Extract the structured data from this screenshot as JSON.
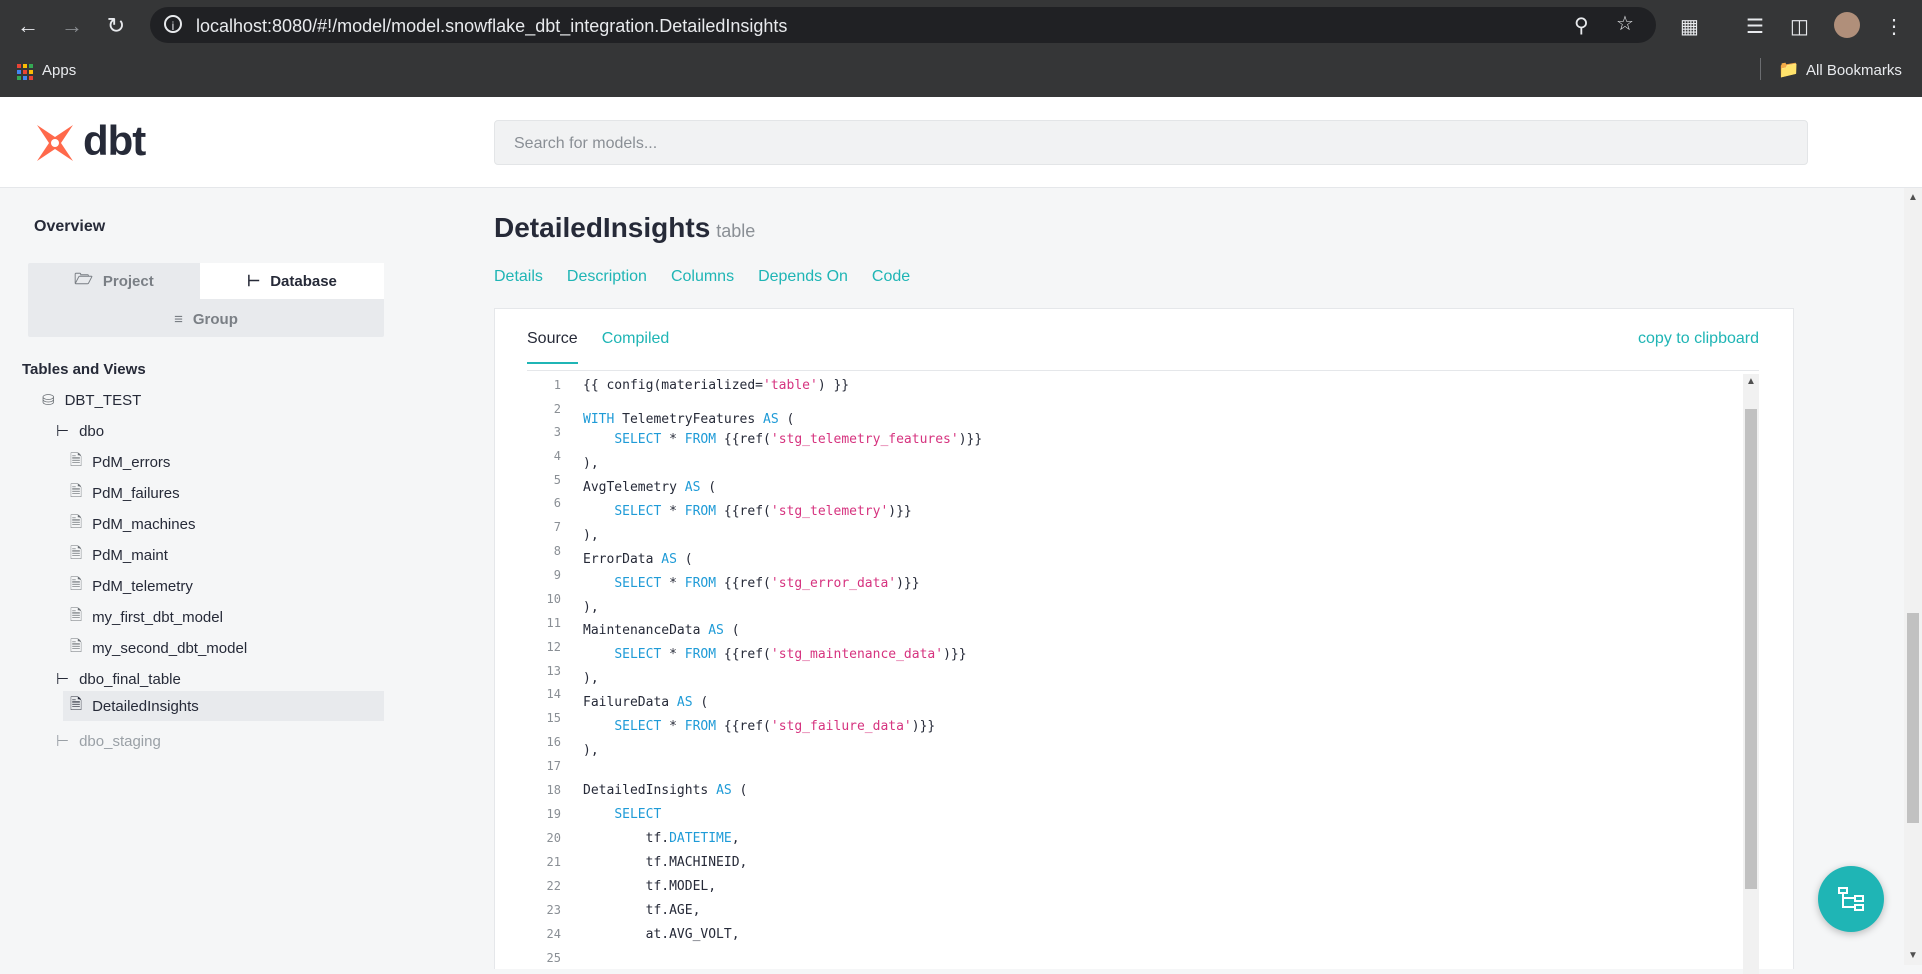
{
  "browser": {
    "url": "localhost:8080/#!/model/model.snowflake_dbt_integration.DetailedInsights",
    "bookmarks": {
      "apps_label": "Apps",
      "all_bookmarks_label": "All Bookmarks"
    }
  },
  "header": {
    "logo_text": "dbt",
    "search_placeholder": "Search for models...",
    "brand_color": "#ff694b"
  },
  "sidebar": {
    "overview_label": "Overview",
    "tabs": [
      {
        "label": "Project",
        "icon": "folder-icon",
        "active": false
      },
      {
        "label": "Database",
        "icon": "tree-icon",
        "active": true
      },
      {
        "label": "Group",
        "icon": "filter-icon",
        "active": false
      }
    ],
    "section_title": "Tables and Views",
    "tree": [
      {
        "label": "DBT_TEST",
        "icon": "database-icon"
      },
      {
        "label": "dbo",
        "icon": "schema-icon"
      },
      {
        "label": "PdM_errors",
        "icon": "file-icon"
      },
      {
        "label": "PdM_failures",
        "icon": "file-icon"
      },
      {
        "label": "PdM_machines",
        "icon": "file-icon"
      },
      {
        "label": "PdM_maint",
        "icon": "file-icon"
      },
      {
        "label": "PdM_telemetry",
        "icon": "file-icon"
      },
      {
        "label": "my_first_dbt_model",
        "icon": "file-icon"
      },
      {
        "label": "my_second_dbt_model",
        "icon": "file-icon"
      },
      {
        "label": "dbo_final_table",
        "icon": "schema-icon"
      },
      {
        "label": "DetailedInsights",
        "icon": "file-icon",
        "selected": true
      },
      {
        "label": "dbo_staging",
        "icon": "schema-icon",
        "muted": true
      }
    ]
  },
  "main": {
    "title": "DetailedInsights",
    "subtitle": "table",
    "tabs": [
      "Details",
      "Description",
      "Columns",
      "Depends On",
      "Code"
    ],
    "code_tabs": [
      "Source",
      "Compiled"
    ],
    "copy_label": "copy to clipboard",
    "accent_color": "#1fb5b5",
    "code_lines": [
      "{{ config(materialized='table') }}",
      "",
      "WITH TelemetryFeatures AS (",
      "    SELECT * FROM {{ref('stg_telemetry_features')}}",
      "),",
      "AvgTelemetry AS (",
      "    SELECT * FROM {{ref('stg_telemetry')}}",
      "),",
      "ErrorData AS (",
      "    SELECT * FROM {{ref('stg_error_data')}}",
      "),",
      "MaintenanceData AS (",
      "    SELECT * FROM {{ref('stg_maintenance_data')}}",
      "),",
      "FailureData AS (",
      "    SELECT * FROM {{ref('stg_failure_data')}}",
      "),",
      "",
      "DetailedInsights AS (",
      "    SELECT",
      "        tf.DATETIME,",
      "        tf.MACHINEID,",
      "        tf.MODEL,",
      "        tf.AGE,",
      "        at.AVG_VOLT,"
    ],
    "line_numbers": [
      "1",
      "2",
      "3",
      "4",
      "5",
      "6",
      "7",
      "8",
      "9",
      "10",
      "11",
      "12",
      "13",
      "14",
      "15",
      "16",
      "17",
      "18",
      "19",
      "20",
      "21",
      "22",
      "23",
      "24",
      "25"
    ]
  }
}
